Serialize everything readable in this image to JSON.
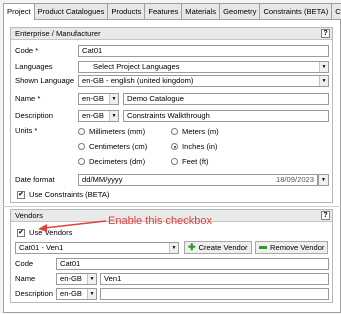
{
  "tabs": [
    "Project",
    "Product Catalogues",
    "Products",
    "Features",
    "Materials",
    "Geometry",
    "Constraints (BETA)",
    "Co"
  ],
  "enterprise": {
    "title": "Enterprise / Manufacturer",
    "help": "?",
    "code_label": "Code *",
    "code_value": "Cat01",
    "languages_label": "Languages",
    "languages_value": "Select Project Languages",
    "shown_language_label": "Shown Language",
    "shown_language_value": "en-GB - english (united kingdom)",
    "name_label": "Name *",
    "name_lang": "en-GB",
    "name_value": "Demo Catalogue",
    "description_label": "Description",
    "description_lang": "en-GB",
    "description_value": "Constraints Walkthrough",
    "units_label": "Units *",
    "units": [
      {
        "label": "Millimeters (mm)",
        "selected": false
      },
      {
        "label": "Meters (m)",
        "selected": false
      },
      {
        "label": "Centimeters (cm)",
        "selected": false
      },
      {
        "label": "Inches (in)",
        "selected": true
      },
      {
        "label": "Decimeters (dm)",
        "selected": false
      },
      {
        "label": "Feet (ft)",
        "selected": false
      }
    ],
    "date_format_label": "Date format",
    "date_format_value": "dd/MM/yyyy",
    "date_preview": "18/09/2023",
    "use_constraints_label": "Use Constraints (BETA)"
  },
  "vendors": {
    "title": "Vendors",
    "help": "?",
    "use_vendors_label": "Use Vendors",
    "annotation": "Enable this checkbox",
    "vendor_select_value": "Cat01 - Ven1",
    "create_vendor_label": "Create Vendor",
    "remove_vendor_label": "Remove Vendor",
    "code_label": "Code",
    "code_value": "Cat01",
    "name_label": "Name",
    "name_lang": "en-GB",
    "name_value": "Ven1",
    "description_label": "Description",
    "description_lang": "en-GB",
    "description_value": ""
  },
  "colors": {
    "annotation": "#e5403a",
    "accent_green": "#2e9a2e"
  }
}
